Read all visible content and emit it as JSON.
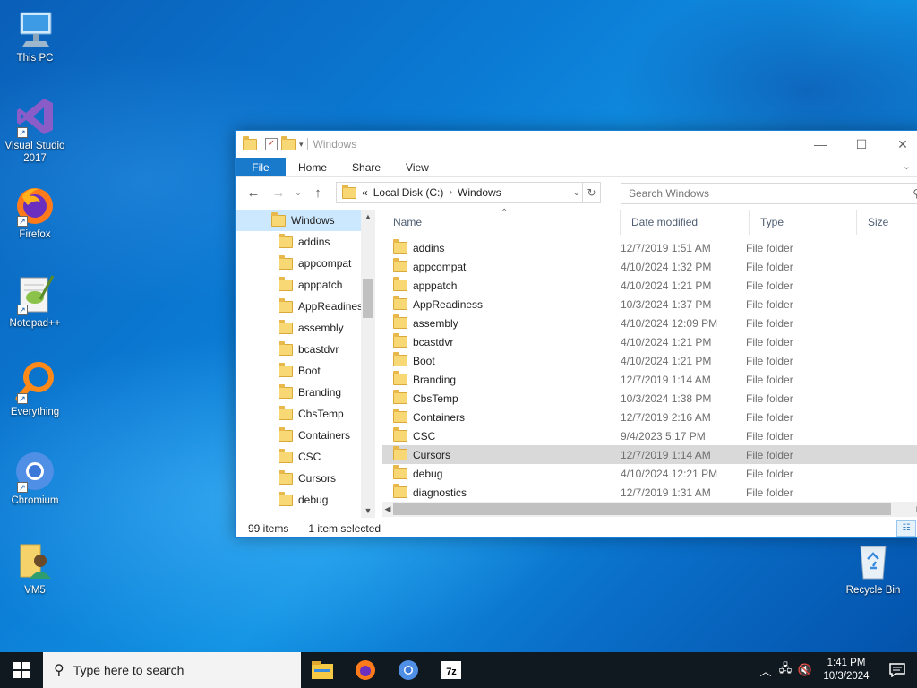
{
  "desktop": {
    "icons": [
      {
        "label": "This PC"
      },
      {
        "label": "Visual Studio 2017"
      },
      {
        "label": "Firefox"
      },
      {
        "label": "Notepad++"
      },
      {
        "label": "Everything"
      },
      {
        "label": "Chromium"
      },
      {
        "label": "VM5"
      },
      {
        "label": "Recycle Bin"
      }
    ]
  },
  "window": {
    "title": "Windows",
    "ribbon": {
      "file": "File",
      "tabs": [
        "Home",
        "Share",
        "View"
      ]
    },
    "address": {
      "prefix": "«",
      "parts": [
        "Local Disk (C:)",
        "Windows"
      ]
    },
    "search_placeholder": "Search Windows",
    "nav_tree": [
      "Windows",
      "addins",
      "appcompat",
      "apppatch",
      "AppReadines",
      "assembly",
      "bcastdvr",
      "Boot",
      "Branding",
      "CbsTemp",
      "Containers",
      "CSC",
      "Cursors",
      "debug"
    ],
    "columns": {
      "name": "Name",
      "date": "Date modified",
      "type": "Type",
      "size": "Size"
    },
    "files": [
      {
        "name": "addins",
        "date": "12/7/2019 1:51 AM",
        "type": "File folder"
      },
      {
        "name": "appcompat",
        "date": "4/10/2024 1:32 PM",
        "type": "File folder"
      },
      {
        "name": "apppatch",
        "date": "4/10/2024 1:21 PM",
        "type": "File folder"
      },
      {
        "name": "AppReadiness",
        "date": "10/3/2024 1:37 PM",
        "type": "File folder"
      },
      {
        "name": "assembly",
        "date": "4/10/2024 12:09 PM",
        "type": "File folder"
      },
      {
        "name": "bcastdvr",
        "date": "4/10/2024 1:21 PM",
        "type": "File folder"
      },
      {
        "name": "Boot",
        "date": "4/10/2024 1:21 PM",
        "type": "File folder"
      },
      {
        "name": "Branding",
        "date": "12/7/2019 1:14 AM",
        "type": "File folder"
      },
      {
        "name": "CbsTemp",
        "date": "10/3/2024 1:38 PM",
        "type": "File folder"
      },
      {
        "name": "Containers",
        "date": "12/7/2019 2:16 AM",
        "type": "File folder"
      },
      {
        "name": "CSC",
        "date": "9/4/2023 5:17 PM",
        "type": "File folder"
      },
      {
        "name": "Cursors",
        "date": "12/7/2019 1:14 AM",
        "type": "File folder",
        "selected": true
      },
      {
        "name": "debug",
        "date": "4/10/2024 12:21 PM",
        "type": "File folder"
      },
      {
        "name": "diagnostics",
        "date": "12/7/2019 1:31 AM",
        "type": "File folder"
      }
    ],
    "status": {
      "count": "99 items",
      "selection": "1 item selected"
    }
  },
  "taskbar": {
    "search_placeholder": "Type here to search",
    "apps": [
      "file-explorer",
      "firefox",
      "chromium",
      "7zip"
    ],
    "clock": {
      "time": "1:41 PM",
      "date": "10/3/2024"
    }
  }
}
